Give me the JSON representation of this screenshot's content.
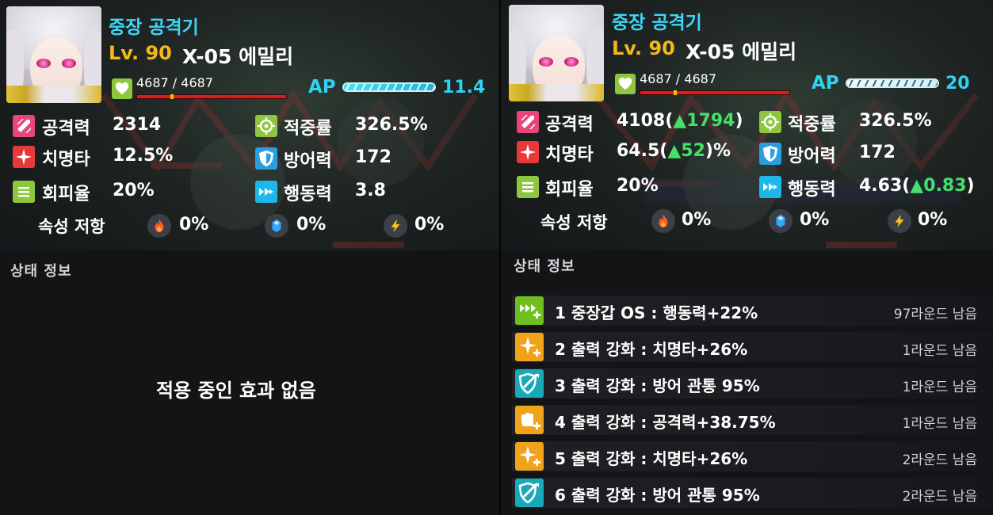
{
  "left": {
    "class_name": "중장 공격기",
    "level": "Lv. 90",
    "unit_name": "X-05 에밀리",
    "hp": "4687 / 4687",
    "ap_label": "AP",
    "ap_value": "11.4",
    "stats": {
      "attack_label": "공격력",
      "attack_value": "2314",
      "crit_label": "치명타",
      "crit_value": "12.5%",
      "evasion_label": "회피율",
      "evasion_value": "20%",
      "accuracy_label": "적중률",
      "accuracy_value": "326.5%",
      "defense_label": "방어력",
      "defense_value": "172",
      "speed_label": "행동력",
      "speed_value": "3.8"
    },
    "resist_title": "속성 저항",
    "resist": {
      "fire": "0%",
      "ice": "0%",
      "electric": "0%"
    },
    "status_title": "상태 정보",
    "empty_message": "적용 중인 효과 없음"
  },
  "right": {
    "class_name": "중장 공격기",
    "level": "Lv. 90",
    "unit_name": "X-05 에밀리",
    "hp": "4687 / 4687",
    "ap_label": "AP",
    "ap_value": "20",
    "stats": {
      "attack_label": "공격력",
      "attack_base": "4108(",
      "attack_bonus": "▲1794",
      "attack_close": ")",
      "crit_label": "치명타",
      "crit_base": "64.5(",
      "crit_bonus": "▲52",
      "crit_close": ")%",
      "evasion_label": "회피율",
      "evasion_value": "20%",
      "accuracy_label": "적중률",
      "accuracy_value": "326.5%",
      "defense_label": "방어력",
      "defense_value": "172",
      "speed_label": "행동력",
      "speed_base": "4.63(",
      "speed_bonus": "▲0.83",
      "speed_close": ")"
    },
    "resist_title": "속성 저항",
    "resist": {
      "fire": "0%",
      "ice": "0%",
      "electric": "0%"
    },
    "status_title": "상태 정보",
    "effects": [
      {
        "text": "1 중장갑 OS : 행동력+22%",
        "duration": "97라운드 남음",
        "icon": "speed-up-icon",
        "color": "#6fbf1f"
      },
      {
        "text": "2 출력 강화 : 치명타+26%",
        "duration": "1라운드 남음",
        "icon": "crit-up-icon",
        "color": "#f0a21a"
      },
      {
        "text": "3 출력 강화 : 방어 관통 95%",
        "duration": "1라운드 남음",
        "icon": "armor-pierce-icon",
        "color": "#1aa9b8"
      },
      {
        "text": "4 출력 강화 : 공격력+38.75%",
        "duration": "1라운드 남음",
        "icon": "attack-up-icon",
        "color": "#f0a21a"
      },
      {
        "text": "5 출력 강화 : 치명타+26%",
        "duration": "2라운드 남음",
        "icon": "crit-up-icon",
        "color": "#f0a21a"
      },
      {
        "text": "6 출력 강화 : 방어 관통 95%",
        "duration": "2라운드 남음",
        "icon": "armor-pierce-icon",
        "color": "#1aa9b8"
      }
    ]
  },
  "colors": {
    "class": "#3fd6f5",
    "level": "#f5b81c",
    "ap": "#2fd3ef",
    "bonus": "#43e06a",
    "hp_icon": "#8dc63f",
    "hp_bar": "#d61e1e",
    "attack": "#e8457a",
    "crit": "#e8393a",
    "evasion": "#8dc63f",
    "accuracy": "#8dc63f",
    "defense": "#2a9fe0",
    "speed": "#1fb7ea"
  }
}
